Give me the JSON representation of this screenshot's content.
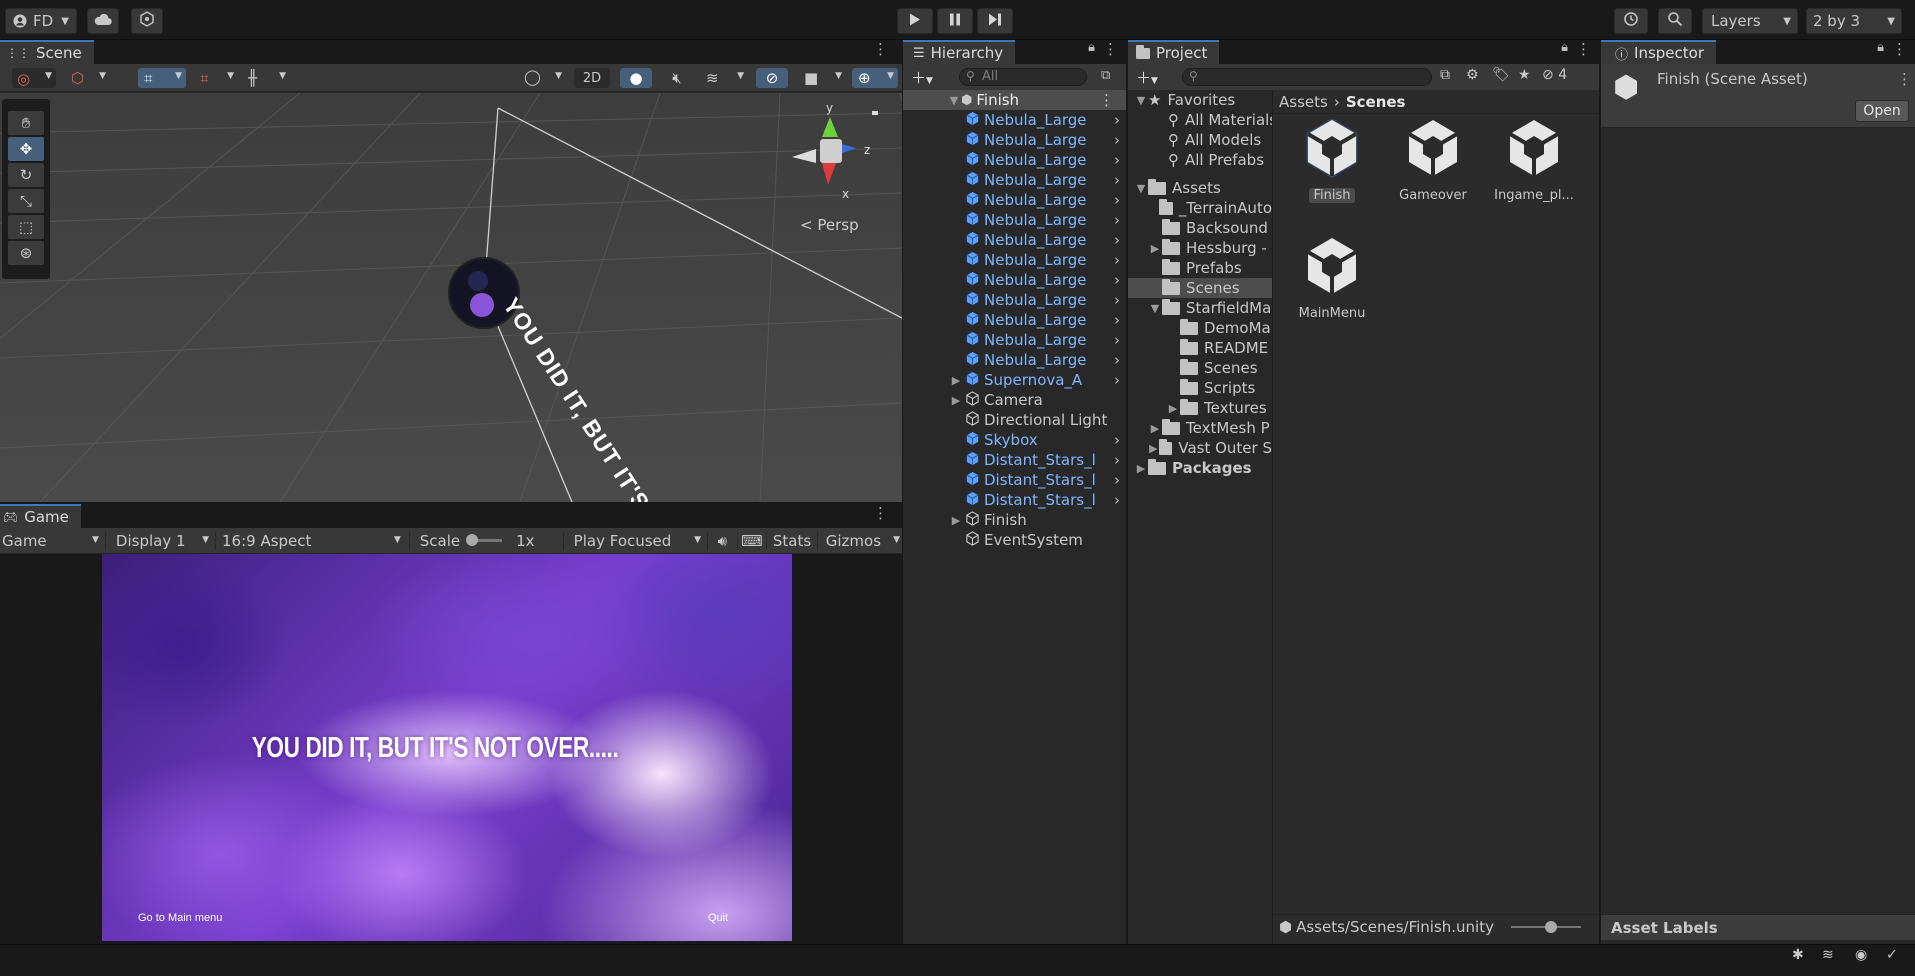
{
  "toolbar": {
    "account_label": "FD",
    "play_icon": "play-icon",
    "pause_icon": "pause-icon",
    "step_icon": "step-icon",
    "layers_label": "Layers",
    "layout_label": "2 by 3"
  },
  "scene": {
    "tab_label": "Scene",
    "mode_2d_label": "2D",
    "persp_label": "Persp",
    "gizmo_y": "y",
    "gizmo_z": "z",
    "gizmo_x": "x",
    "world_text": "YOU DID IT, BUT IT'S NOT O"
  },
  "game": {
    "tab_label": "Game",
    "view_select": "Game",
    "display_select": "Display 1",
    "aspect_select": "16:9 Aspect",
    "scale_label": "Scale",
    "scale_value": "1x",
    "play_focused": "Play Focused",
    "stats_label": "Stats",
    "gizmos_label": "Gizmos",
    "message": "YOU DID IT, BUT IT'S NOT OVER.....",
    "main_menu_button": "Go to Main menu",
    "quit_button": "Quit"
  },
  "hierarchy": {
    "tab_label": "Hierarchy",
    "search_placeholder": "All",
    "scene_name": "Finish",
    "items": [
      {
        "label": "Nebula_Large",
        "prefab": true,
        "arrow": true,
        "expand": false
      },
      {
        "label": "Nebula_Large",
        "prefab": true,
        "arrow": true,
        "expand": false
      },
      {
        "label": "Nebula_Large",
        "prefab": true,
        "arrow": true,
        "expand": false
      },
      {
        "label": "Nebula_Large",
        "prefab": true,
        "arrow": true,
        "expand": false
      },
      {
        "label": "Nebula_Large",
        "prefab": true,
        "arrow": true,
        "expand": false
      },
      {
        "label": "Nebula_Large",
        "prefab": true,
        "arrow": true,
        "expand": false
      },
      {
        "label": "Nebula_Large",
        "prefab": true,
        "arrow": true,
        "expand": false
      },
      {
        "label": "Nebula_Large",
        "prefab": true,
        "arrow": true,
        "expand": false
      },
      {
        "label": "Nebula_Large",
        "prefab": true,
        "arrow": true,
        "expand": false
      },
      {
        "label": "Nebula_Large",
        "prefab": true,
        "arrow": true,
        "expand": false
      },
      {
        "label": "Nebula_Large",
        "prefab": true,
        "arrow": true,
        "expand": false
      },
      {
        "label": "Nebula_Large",
        "prefab": true,
        "arrow": true,
        "expand": false
      },
      {
        "label": "Nebula_Large",
        "prefab": true,
        "arrow": true,
        "expand": false
      },
      {
        "label": "Supernova_A",
        "prefab": true,
        "arrow": true,
        "expand": true
      },
      {
        "label": "Camera",
        "prefab": false,
        "arrow": false,
        "expand": true
      },
      {
        "label": "Directional Light",
        "prefab": false,
        "arrow": false,
        "expand": false
      },
      {
        "label": "Skybox",
        "prefab": true,
        "arrow": true,
        "expand": false
      },
      {
        "label": "Distant_Stars_l",
        "prefab": true,
        "arrow": true,
        "expand": false
      },
      {
        "label": "Distant_Stars_l",
        "prefab": true,
        "arrow": true,
        "expand": false
      },
      {
        "label": "Distant_Stars_l",
        "prefab": true,
        "arrow": true,
        "expand": false
      },
      {
        "label": "Finish",
        "prefab": false,
        "arrow": false,
        "expand": true
      },
      {
        "label": "EventSystem",
        "prefab": false,
        "arrow": false,
        "expand": false
      }
    ]
  },
  "project": {
    "tab_label": "Project",
    "hidden_count": "4",
    "favorites_label": "Favorites",
    "favorites": [
      "All Materials",
      "All Models",
      "All Prefabs"
    ],
    "assets_label": "Assets",
    "tree": [
      {
        "label": "_TerrainAuto",
        "expand": false,
        "indent": 1
      },
      {
        "label": "Backsound",
        "expand": false,
        "indent": 1
      },
      {
        "label": "Hessburg -",
        "expand": true,
        "indent": 1
      },
      {
        "label": "Prefabs",
        "expand": false,
        "indent": 1
      },
      {
        "label": "Scenes",
        "expand": false,
        "indent": 1,
        "selected": true
      },
      {
        "label": "StarfieldMa",
        "expand": true,
        "indent": 1,
        "open": true
      },
      {
        "label": "DemoMa",
        "expand": false,
        "indent": 2
      },
      {
        "label": "README",
        "expand": false,
        "indent": 2
      },
      {
        "label": "Scenes",
        "expand": false,
        "indent": 2
      },
      {
        "label": "Scripts",
        "expand": false,
        "indent": 2
      },
      {
        "label": "Textures",
        "expand": true,
        "indent": 2
      },
      {
        "label": "TextMesh P",
        "expand": true,
        "indent": 1
      },
      {
        "label": "Vast Outer S",
        "expand": true,
        "indent": 1
      }
    ],
    "packages_label": "Packages",
    "breadcrumb_root": "Assets",
    "breadcrumb_current": "Scenes",
    "assets": [
      "Finish",
      "Gameover",
      "Ingame_pl...",
      "MainMenu"
    ],
    "footer_path": "Assets/Scenes/Finish.unity"
  },
  "inspector": {
    "tab_label": "Inspector",
    "title": "Finish (Scene Asset)",
    "open_button": "Open",
    "asset_labels": "Asset Labels"
  }
}
